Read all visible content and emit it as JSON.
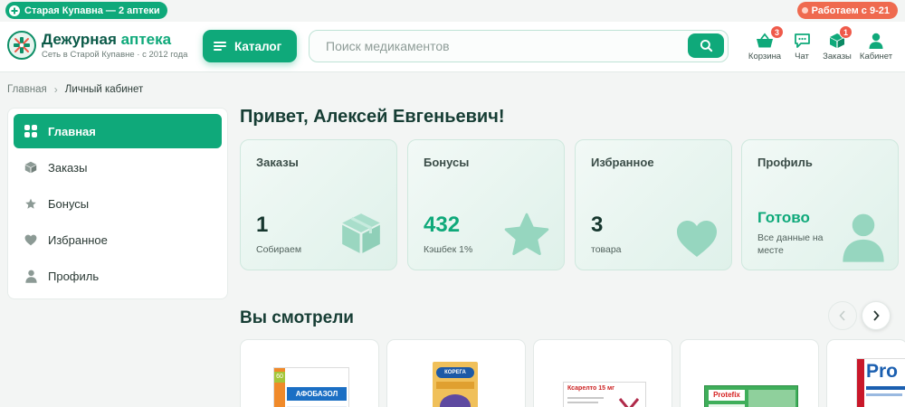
{
  "topbar": {
    "city": "Старая Купавна — 2 аптеки",
    "hours": "Работаем с 9-21"
  },
  "header": {
    "brand_main": "Дежурная ",
    "brand_accent": "аптека",
    "brand_sub": "Сеть в Старой Купавне · с 2012 года",
    "catalog_label": "Каталог",
    "search_placeholder": "Поиск медикаментов",
    "icons": {
      "cart": {
        "label": "Корзина",
        "badge": "3",
        "icon": "basket-icon"
      },
      "chat": {
        "label": "Чат",
        "icon": "chat-icon"
      },
      "orders": {
        "label": "Заказы",
        "badge": "1",
        "icon": "box-icon"
      },
      "cabinet": {
        "label": "Кабинет",
        "icon": "user-icon"
      }
    }
  },
  "breadcrumb": {
    "home": "Главная",
    "current": "Личный кабинет"
  },
  "sidebar": {
    "items": [
      {
        "label": "Главная",
        "icon": "grid-icon",
        "active": true
      },
      {
        "label": "Заказы",
        "icon": "box-icon"
      },
      {
        "label": "Бонусы",
        "icon": "star-icon"
      },
      {
        "label": "Избранное",
        "icon": "heart-icon"
      },
      {
        "label": "Профиль",
        "icon": "user-icon"
      }
    ]
  },
  "main": {
    "greeting": "Привет, Алексей Евгеньевич!",
    "cards": [
      {
        "title": "Заказы",
        "value": "1",
        "sub": "Собираем",
        "icon": "box-icon"
      },
      {
        "title": "Бонусы",
        "value": "432",
        "sub": "Кэшбек 1%",
        "icon": "star-icon"
      },
      {
        "title": "Избранное",
        "value": "3",
        "sub": "товара",
        "icon": "heart-icon"
      },
      {
        "title": "Профиль",
        "value": "Готово",
        "sub": "Все данные на месте",
        "icon": "user-icon"
      }
    ],
    "viewed_title": "Вы смотрели",
    "products": [
      {
        "box_label": "АФОБАЗОЛ"
      },
      {
        "box_label": "КОРЕГА"
      },
      {
        "box_label": "Ксарелто 15 мг"
      },
      {
        "box_label": "Protefix"
      },
      {
        "box_label": "Pro"
      }
    ]
  },
  "colors": {
    "brand": "#0fa97a",
    "brand_dark": "#0b5a48",
    "badge": "#ef5a4a",
    "hours_pill": "#ef6a4f"
  }
}
